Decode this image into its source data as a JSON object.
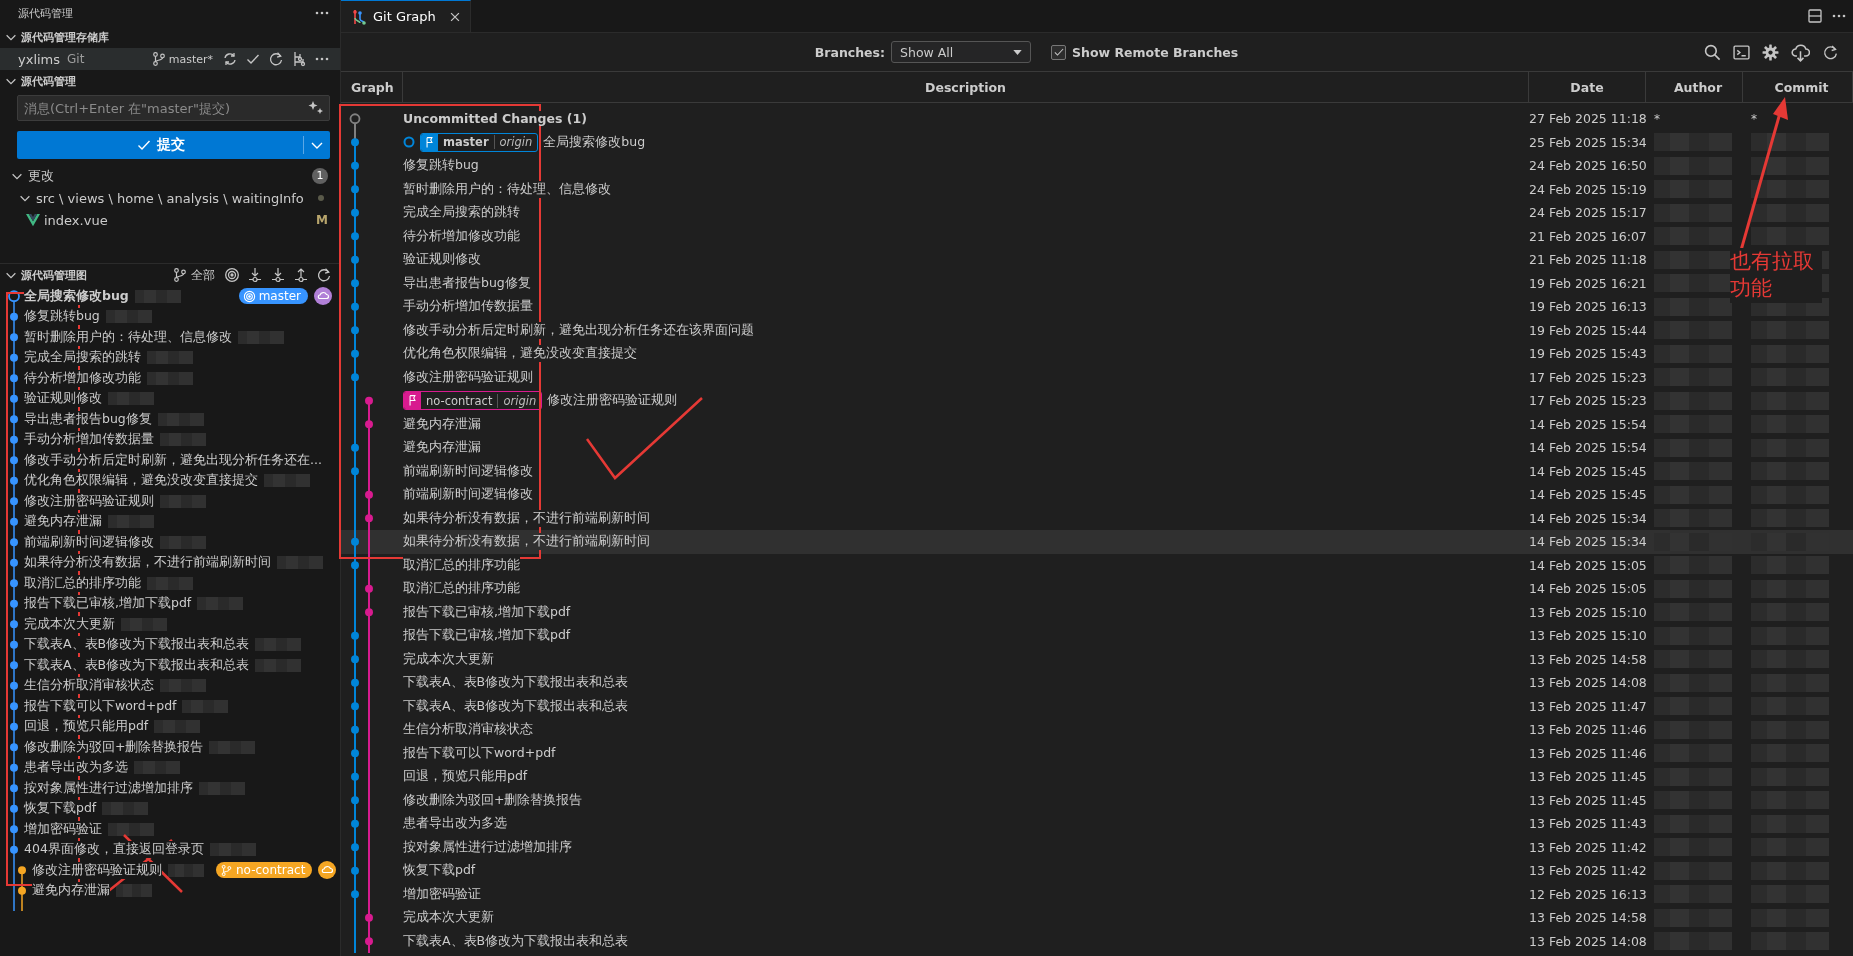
{
  "sidebar": {
    "title": "源代码管理",
    "repositories": {
      "heading": "源代码管理存储库",
      "expanded": true,
      "repos": [
        {
          "name": "yxlims",
          "provider": "Git",
          "branch": "master*",
          "selected": true
        }
      ]
    },
    "changes_section": {
      "heading": "源代码管理",
      "expanded": true,
      "message_placeholder": "消息(Ctrl+Enter 在\"master\"提交)",
      "commit_button": "提交",
      "changes": {
        "label": "更改",
        "expanded": true,
        "count": "1",
        "folder": {
          "path": "src \\ views \\ home \\ analysis \\ waitingInfo",
          "expanded": true
        },
        "files": [
          {
            "name": "index.vue",
            "status": "M"
          }
        ]
      }
    },
    "graph_section": {
      "heading": "源代码管理图",
      "expanded": true,
      "filter": "全部",
      "commits": [
        {
          "text": "全局搜索修改bug",
          "kind": "main",
          "color": "#3794ff",
          "current": true,
          "redacted": true,
          "ref": {
            "name": "master",
            "color": "#3794ff"
          },
          "cloud": {
            "color": "#b180d7"
          }
        },
        {
          "text": "修复跳转bug",
          "kind": "main",
          "color": "#3794ff",
          "current": false,
          "redacted": true
        },
        {
          "text": "暂时删除用户的：待处理、信息修改",
          "kind": "main",
          "color": "#3794ff",
          "current": false,
          "redacted": true
        },
        {
          "text": "完成全局搜索的跳转",
          "kind": "main",
          "color": "#3794ff",
          "current": false,
          "redacted": true
        },
        {
          "text": "待分析增加修改功能",
          "kind": "main",
          "color": "#3794ff",
          "current": false,
          "redacted": true
        },
        {
          "text": "验证规则修改",
          "kind": "main",
          "color": "#3794ff",
          "current": false,
          "redacted": true
        },
        {
          "text": "导出患者报告bug修复",
          "kind": "main",
          "color": "#3794ff",
          "current": false,
          "redacted": true
        },
        {
          "text": "手动分析增加传数据量",
          "kind": "main",
          "color": "#3794ff",
          "current": false,
          "redacted": true
        },
        {
          "text": "修改手动分析后定时刷新，避免出现分析任务还在...",
          "kind": "main",
          "color": "#3794ff",
          "current": false,
          "redacted": false
        },
        {
          "text": "优化角色权限编辑，避免没改变直接提交",
          "kind": "main",
          "color": "#3794ff",
          "current": false,
          "redacted": true
        },
        {
          "text": "修改注册密码验证规则",
          "kind": "main",
          "color": "#3794ff",
          "current": false,
          "redacted": true
        },
        {
          "text": "避免内存泄漏",
          "kind": "main",
          "color": "#3794ff",
          "current": false,
          "redacted": true
        },
        {
          "text": "前端刷新时间逻辑修改",
          "kind": "main",
          "color": "#3794ff",
          "current": false,
          "redacted": true
        },
        {
          "text": "如果待分析没有数据，不进行前端刷新时间",
          "kind": "main",
          "color": "#3794ff",
          "current": false,
          "redacted": true
        },
        {
          "text": "取消汇总的排序功能",
          "kind": "main",
          "color": "#3794ff",
          "current": false,
          "redacted": true
        },
        {
          "text": "报告下载已审核,增加下载pdf",
          "kind": "main",
          "color": "#3794ff",
          "current": false,
          "redacted": true
        },
        {
          "text": "完成本次大更新",
          "kind": "main",
          "color": "#3794ff",
          "current": false,
          "redacted": true
        },
        {
          "text": "下载表A、表B修改为下载报出表和总表",
          "kind": "main",
          "color": "#3794ff",
          "current": false,
          "redacted": true
        },
        {
          "text": "下载表A、表B修改为下载报出表和总表",
          "kind": "main",
          "color": "#3794ff",
          "current": false,
          "redacted": true
        },
        {
          "text": "生信分析取消审核状态",
          "kind": "main",
          "color": "#3794ff",
          "current": false,
          "redacted": true
        },
        {
          "text": "报告下载可以下word+pdf",
          "kind": "main",
          "color": "#3794ff",
          "current": false,
          "redacted": true
        },
        {
          "text": "回退，预览只能用pdf",
          "kind": "main",
          "color": "#3794ff",
          "current": false,
          "redacted": true
        },
        {
          "text": "修改删除为驳回+删除替换报告",
          "kind": "main",
          "color": "#3794ff",
          "current": false,
          "redacted": true
        },
        {
          "text": "患者导出改为多选",
          "kind": "main",
          "color": "#3794ff",
          "current": false,
          "redacted": true
        },
        {
          "text": "按对象属性进行过滤增加排序",
          "kind": "main",
          "color": "#3794ff",
          "current": false,
          "redacted": true
        },
        {
          "text": "恢复下载pdf",
          "kind": "main",
          "color": "#3794ff",
          "current": false,
          "redacted": true
        },
        {
          "text": "增加密码验证",
          "kind": "main",
          "color": "#3794ff",
          "current": false,
          "redacted": true
        },
        {
          "text": "404界面修改，直接返回登录页",
          "kind": "main",
          "color": "#3794ff",
          "current": false,
          "redacted": true
        },
        {
          "text": "修改注册密码验证规则",
          "kind": "side",
          "color": "#f5a623",
          "current": false,
          "redacted": true,
          "ref": {
            "name": "no-contract",
            "color": "#f5a623"
          },
          "cloud": {
            "color": "#f5a623"
          }
        },
        {
          "text": "避免内存泄漏",
          "kind": "side",
          "color": "#f5a623",
          "current": false,
          "redacted": true
        }
      ]
    }
  },
  "editor": {
    "tabs": [
      {
        "label": "Git Graph",
        "selected": true
      }
    ],
    "toolbar": {
      "branches_label": "Branches:",
      "branches_value": "Show All",
      "show_remote": {
        "label": "Show Remote Branches",
        "checked": true
      }
    },
    "table": {
      "columns": [
        "Graph",
        "Description",
        "Date",
        "Author",
        "Commit"
      ],
      "rows": [
        {
          "kind": "uncommitted",
          "color": "#808080",
          "description": "Uncommitted Changes (1)",
          "date": "27 Feb 2025 11:18",
          "author": "*",
          "commit": "*",
          "redacted": false,
          "head": false,
          "highlighted": false
        },
        {
          "kind": "main",
          "color": "#0085d9",
          "description": "全局搜索修改bug",
          "date": "25 Feb 2025 15:34",
          "redacted": true,
          "head": true,
          "highlighted": false,
          "refs": [
            {
              "name": "master",
              "remote": "origin"
            }
          ]
        },
        {
          "kind": "main",
          "color": "#0085d9",
          "description": "修复跳转bug",
          "date": "24 Feb 2025 16:50",
          "redacted": true,
          "head": false,
          "highlighted": false
        },
        {
          "kind": "main",
          "color": "#0085d9",
          "description": "暂时删除用户的：待处理、信息修改",
          "date": "24 Feb 2025 15:19",
          "redacted": true,
          "head": false,
          "highlighted": false
        },
        {
          "kind": "main",
          "color": "#0085d9",
          "description": "完成全局搜索的跳转",
          "date": "24 Feb 2025 15:17",
          "redacted": true,
          "head": false,
          "highlighted": false
        },
        {
          "kind": "main",
          "color": "#0085d9",
          "description": "待分析增加修改功能",
          "date": "21 Feb 2025 16:07",
          "redacted": true,
          "head": false,
          "highlighted": false
        },
        {
          "kind": "main",
          "color": "#0085d9",
          "description": "验证规则修改",
          "date": "21 Feb 2025 11:18",
          "redacted": true,
          "head": false,
          "highlighted": false
        },
        {
          "kind": "main",
          "color": "#0085d9",
          "description": "导出患者报告bug修复",
          "date": "19 Feb 2025 16:21",
          "redacted": true,
          "head": false,
          "highlighted": false
        },
        {
          "kind": "main",
          "color": "#0085d9",
          "description": "手动分析增加传数据量",
          "date": "19 Feb 2025 16:13",
          "redacted": true,
          "head": false,
          "highlighted": false
        },
        {
          "kind": "main",
          "color": "#0085d9",
          "description": "修改手动分析后定时刷新，避免出现分析任务还在该界面问题",
          "date": "19 Feb 2025 15:44",
          "redacted": true,
          "head": false,
          "highlighted": false
        },
        {
          "kind": "main",
          "color": "#0085d9",
          "description": "优化角色权限编辑，避免没改变直接提交",
          "date": "19 Feb 2025 15:43",
          "redacted": true,
          "head": false,
          "highlighted": false
        },
        {
          "kind": "main",
          "color": "#0085d9",
          "description": "修改注册密码验证规则",
          "date": "17 Feb 2025 15:23",
          "redacted": true,
          "head": false,
          "highlighted": false
        },
        {
          "kind": "side",
          "color": "#d81b8f",
          "description": "修改注册密码验证规则",
          "date": "17 Feb 2025 15:23",
          "redacted": true,
          "head": false,
          "highlighted": false,
          "refs": [
            {
              "name": "no-contract",
              "remote": "origin"
            }
          ]
        },
        {
          "kind": "side",
          "color": "#d81b8f",
          "description": "避免内存泄漏",
          "date": "14 Feb 2025 15:54",
          "redacted": true,
          "head": false,
          "highlighted": false
        },
        {
          "kind": "main",
          "color": "#0085d9",
          "description": "避免内存泄漏",
          "date": "14 Feb 2025 15:54",
          "redacted": true,
          "head": false,
          "highlighted": false
        },
        {
          "kind": "main",
          "color": "#0085d9",
          "description": "前端刷新时间逻辑修改",
          "date": "14 Feb 2025 15:45",
          "redacted": true,
          "head": false,
          "highlighted": false
        },
        {
          "kind": "side",
          "color": "#d81b8f",
          "description": "前端刷新时间逻辑修改",
          "date": "14 Feb 2025 15:45",
          "redacted": true,
          "head": false,
          "highlighted": false
        },
        {
          "kind": "side",
          "color": "#d81b8f",
          "description": "如果待分析没有数据，不进行前端刷新时间",
          "date": "14 Feb 2025 15:34",
          "redacted": true,
          "head": false,
          "highlighted": false
        },
        {
          "kind": "main",
          "color": "#0085d9",
          "description": "如果待分析没有数据，不进行前端刷新时间",
          "date": "14 Feb 2025 15:34",
          "redacted": true,
          "head": false,
          "highlighted": true
        },
        {
          "kind": "main",
          "color": "#0085d9",
          "description": "取消汇总的排序功能",
          "date": "14 Feb 2025 15:05",
          "redacted": true,
          "head": false,
          "highlighted": false
        },
        {
          "kind": "side",
          "color": "#d81b8f",
          "description": "取消汇总的排序功能",
          "date": "14 Feb 2025 15:05",
          "redacted": true,
          "head": false,
          "highlighted": false
        },
        {
          "kind": "side",
          "color": "#d81b8f",
          "description": "报告下载已审核,增加下载pdf",
          "date": "13 Feb 2025 15:10",
          "redacted": true,
          "head": false,
          "highlighted": false
        },
        {
          "kind": "main",
          "color": "#0085d9",
          "description": "报告下载已审核,增加下载pdf",
          "date": "13 Feb 2025 15:10",
          "redacted": true,
          "head": false,
          "highlighted": false
        },
        {
          "kind": "main",
          "color": "#0085d9",
          "description": "完成本次大更新",
          "date": "13 Feb 2025 14:58",
          "redacted": true,
          "head": false,
          "highlighted": false
        },
        {
          "kind": "main",
          "color": "#0085d9",
          "description": "下载表A、表B修改为下载报出表和总表",
          "date": "13 Feb 2025 14:08",
          "redacted": true,
          "head": false,
          "highlighted": false
        },
        {
          "kind": "main",
          "color": "#0085d9",
          "description": "下载表A、表B修改为下载报出表和总表",
          "date": "13 Feb 2025 11:47",
          "redacted": true,
          "head": false,
          "highlighted": false
        },
        {
          "kind": "main",
          "color": "#0085d9",
          "description": "生信分析取消审核状态",
          "date": "13 Feb 2025 11:46",
          "redacted": true,
          "head": false,
          "highlighted": false
        },
        {
          "kind": "main",
          "color": "#0085d9",
          "description": "报告下载可以下word+pdf",
          "date": "13 Feb 2025 11:46",
          "redacted": true,
          "head": false,
          "highlighted": false
        },
        {
          "kind": "main",
          "color": "#0085d9",
          "description": "回退，预览只能用pdf",
          "date": "13 Feb 2025 11:45",
          "redacted": true,
          "head": false,
          "highlighted": false
        },
        {
          "kind": "main",
          "color": "#0085d9",
          "description": "修改删除为驳回+删除替换报告",
          "date": "13 Feb 2025 11:45",
          "redacted": true,
          "head": false,
          "highlighted": false
        },
        {
          "kind": "main",
          "color": "#0085d9",
          "description": "患者导出改为多选",
          "date": "13 Feb 2025 11:43",
          "redacted": true,
          "head": false,
          "highlighted": false
        },
        {
          "kind": "main",
          "color": "#0085d9",
          "description": "按对象属性进行过滤增加排序",
          "date": "13 Feb 2025 11:42",
          "redacted": true,
          "head": false,
          "highlighted": false
        },
        {
          "kind": "main",
          "color": "#0085d9",
          "description": "恢复下载pdf",
          "date": "13 Feb 2025 11:42",
          "redacted": true,
          "head": false,
          "highlighted": false
        },
        {
          "kind": "main",
          "color": "#0085d9",
          "description": "增加密码验证",
          "date": "12 Feb 2025 16:13",
          "redacted": true,
          "head": false,
          "highlighted": false
        },
        {
          "kind": "side",
          "color": "#d81b8f",
          "description": "完成本次大更新",
          "date": "13 Feb 2025 14:58",
          "redacted": true,
          "head": false,
          "highlighted": false
        },
        {
          "kind": "side",
          "color": "#d81b8f",
          "description": "下载表A、表B修改为下载报出表和总表",
          "date": "13 Feb 2025 14:08",
          "redacted": true,
          "head": false,
          "highlighted": false
        }
      ]
    }
  },
  "annotations": [
    {
      "kind": "box"
    },
    {
      "kind": "box"
    },
    {
      "kind": "check"
    },
    {
      "kind": "cross"
    },
    {
      "kind": "arrow"
    },
    {
      "kind": "note",
      "text": "也有拉取功能"
    }
  ]
}
